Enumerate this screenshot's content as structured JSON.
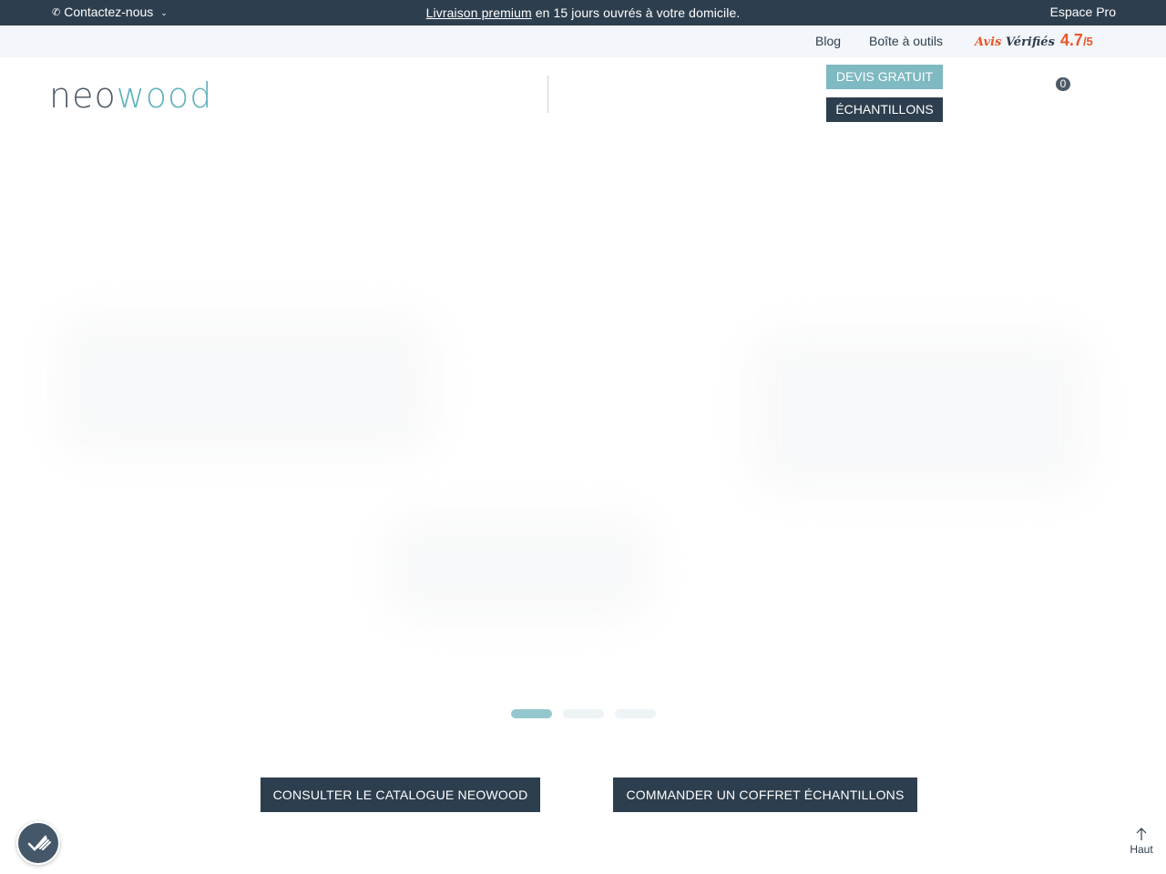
{
  "topbar": {
    "contact_label": "Contactez-nous",
    "promo_link": "Livraison premium",
    "promo_text": " en 15 jours ouvrés à votre domicile.",
    "pro_label": "Espace Pro"
  },
  "subnav": {
    "blog": "Blog",
    "tools": "Boîte à outils",
    "reviews": {
      "brand_a": "Avis",
      "brand_b": "Vérifiés",
      "score": "4.7",
      "scale": "/5"
    }
  },
  "header": {
    "logo_part1": "neo",
    "logo_part2": "wood",
    "devis_label": "DEVIS GRATUIT",
    "echantillons_label": "ÉCHANTILLONS",
    "cart_count": "0"
  },
  "slider": {
    "slide_count": 3,
    "active_index": 0
  },
  "cta": {
    "catalogue": "CONSULTER LE CATALOGUE NEOWOOD",
    "coffret": "COMMANDER UN COFFRET ÉCHANTILLONS"
  },
  "back_to_top": "Haut",
  "colors": {
    "dark_navy": "#2d3e4e",
    "teal": "#7fb9c1",
    "review_orange": "#e8572a"
  }
}
